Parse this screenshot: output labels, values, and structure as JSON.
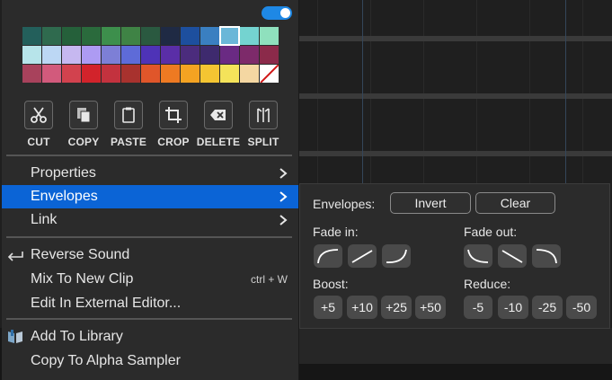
{
  "palette": {
    "colors": [
      [
        "#235f5b",
        "#2f6a4e",
        "#25603a",
        "#2a6a3c",
        "#3d8f4c",
        "#3f8345",
        "#2a5940",
        "#1f2a44",
        "#1d4f9e",
        "#3a7fc1",
        "#6ab7d8",
        "#74d3d0",
        "#8fe0bd"
      ],
      [
        "#b7e4ea",
        "#bcd7f4",
        "#c6b8f0",
        "#ad9bf3",
        "#7d7fd6",
        "#5e6bd8",
        "#4e33b7",
        "#5a2ea7",
        "#4b2c7d",
        "#3e2a6e",
        "#6a2a83",
        "#7d2a6a",
        "#8b2a4a"
      ],
      [
        "#a8425c",
        "#d25a7c",
        "#d2424e",
        "#d2232b",
        "#c3323e",
        "#a8322e",
        "#e0562a",
        "#ee7a22",
        "#f4a322",
        "#f4c532",
        "#f4e35a",
        "#f4d7a2",
        "none"
      ]
    ],
    "selected": [
      0,
      10
    ]
  },
  "tools": [
    {
      "label": "CUT",
      "icon": "scissors-icon"
    },
    {
      "label": "COPY",
      "icon": "copy-icon"
    },
    {
      "label": "PASTE",
      "icon": "clipboard-icon"
    },
    {
      "label": "CROP",
      "icon": "crop-icon"
    },
    {
      "label": "DELETE",
      "icon": "backspace-icon"
    },
    {
      "label": "SPLIT",
      "icon": "split-icon"
    }
  ],
  "menu": {
    "properties": "Properties",
    "envelopes": "Envelopes",
    "link": "Link",
    "reverse_sound": "Reverse Sound",
    "mix_to_new_clip": "Mix To New Clip",
    "mix_shortcut": "ctrl + W",
    "edit_external": "Edit In External Editor...",
    "add_to_library": "Add To Library",
    "copy_to_alpha_sampler": "Copy To Alpha Sampler"
  },
  "envelopes_panel": {
    "title": "Envelopes:",
    "invert": "Invert",
    "clear": "Clear",
    "fade_in": "Fade in:",
    "fade_out": "Fade out:",
    "boost": "Boost:",
    "reduce": "Reduce:",
    "boost_values": [
      "+5",
      "+10",
      "+25",
      "+50"
    ],
    "reduce_values": [
      "-5",
      "-10",
      "-25",
      "-50"
    ]
  },
  "colors": {
    "accent": "#0b64d6",
    "toggle": "#1e88e5",
    "menu_bg": "#2b2b2b"
  }
}
